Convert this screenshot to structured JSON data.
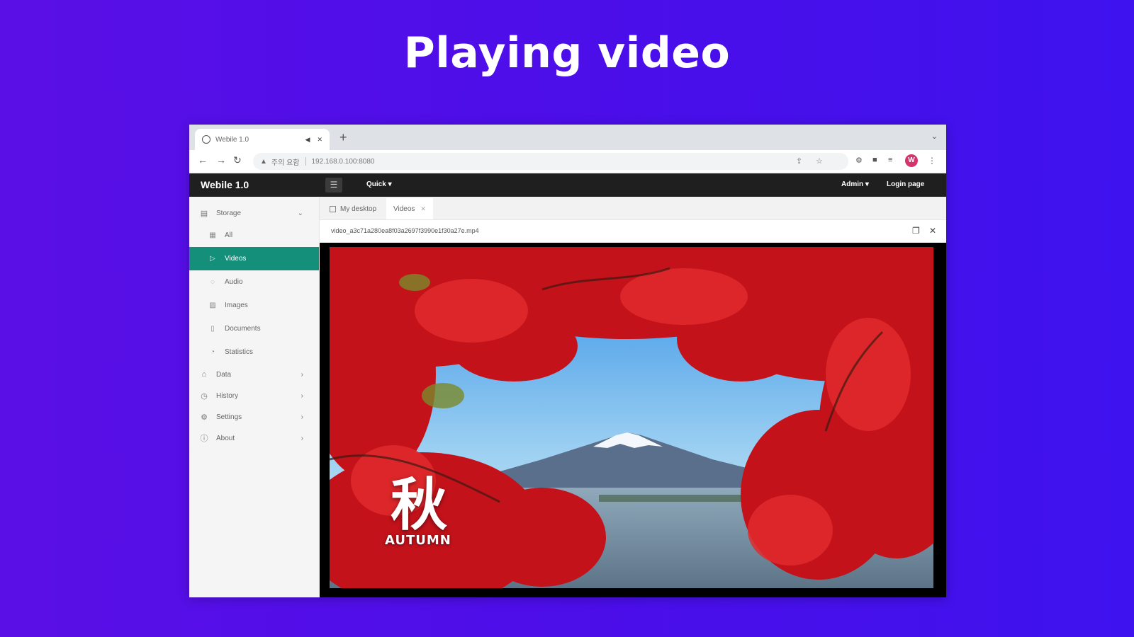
{
  "headline": "Playing video",
  "browser": {
    "tab_title": "Webile 1.0",
    "new_tab": "+",
    "address": {
      "security_label": "주의 요함",
      "url": "192.168.0.100:8080"
    },
    "profile_initial": "W"
  },
  "app": {
    "brand": "Webile 1.0",
    "menu_quick": "Quick",
    "menu_admin": "Admin",
    "login_page": "Login page"
  },
  "sidebar": {
    "storage": "Storage",
    "items": [
      {
        "label": "All"
      },
      {
        "label": "Videos"
      },
      {
        "label": "Audio"
      },
      {
        "label": "Images"
      },
      {
        "label": "Documents"
      },
      {
        "label": "Statistics"
      }
    ],
    "groups": [
      {
        "label": "Data"
      },
      {
        "label": "History"
      },
      {
        "label": "Settings"
      },
      {
        "label": "About"
      }
    ]
  },
  "content": {
    "tabs": [
      {
        "label": "My desktop"
      },
      {
        "label": "Videos"
      }
    ],
    "filename": "video_a3c71a280ea8f03a2697f3990e1f30a27e.mp4"
  },
  "video": {
    "kanji": "秋",
    "caption": "AUTUMN"
  },
  "colors": {
    "background": "#4c0ee9",
    "accent": "#138f7a",
    "appbar": "#1f1f1f"
  }
}
